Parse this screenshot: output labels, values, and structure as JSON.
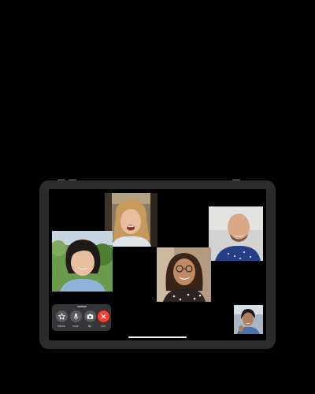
{
  "call": {
    "participants": [
      {
        "role": "remote",
        "tile": "top-center"
      },
      {
        "role": "remote",
        "tile": "right"
      },
      {
        "role": "remote",
        "tile": "left"
      },
      {
        "role": "remote",
        "tile": "center"
      },
      {
        "role": "self",
        "tile": "bottom-right"
      }
    ]
  },
  "controls": {
    "effects": {
      "label": "effects",
      "icon": "star-icon"
    },
    "mute": {
      "label": "mute",
      "icon": "microphone-icon"
    },
    "flip": {
      "label": "flip",
      "icon": "camera-icon"
    },
    "end": {
      "label": "end",
      "icon": "close-icon"
    }
  },
  "colors": {
    "end_button": "#ff3b30",
    "control_bar": "#3a3a3c",
    "device_frame": "#2a2b2d"
  }
}
